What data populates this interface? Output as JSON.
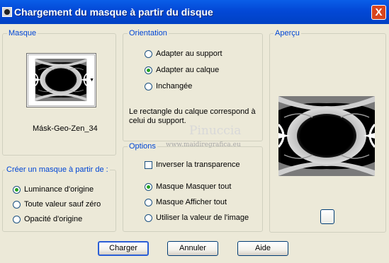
{
  "window": {
    "title": "Chargement du masque à partir du disque",
    "close_label": "X"
  },
  "masque": {
    "legend": "Masque",
    "mask_name": "Másk-Geo-Zen_34",
    "dropdown_arrow": "▼"
  },
  "create_from": {
    "legend": "Créer un masque à partir de :",
    "options": [
      {
        "label": "Luminance d'origine",
        "checked": true
      },
      {
        "label": "Toute valeur sauf zéro",
        "checked": false
      },
      {
        "label": "Opacité d'origine",
        "checked": false
      }
    ]
  },
  "orientation": {
    "legend": "Orientation",
    "options": [
      {
        "label": "Adapter au support",
        "checked": false
      },
      {
        "label": "Adapter au calque",
        "checked": true
      },
      {
        "label": "Inchangée",
        "checked": false
      }
    ],
    "note": "Le rectangle du calque correspond à celui du support."
  },
  "options": {
    "legend": "Options",
    "invert_label": "Inverser la transparence",
    "invert_checked": false,
    "choices": [
      {
        "label": "Masque Masquer tout",
        "checked": true
      },
      {
        "label": "Masque Afficher tout",
        "checked": false
      },
      {
        "label": "Utiliser la valeur de l'image",
        "checked": false
      }
    ]
  },
  "preview": {
    "legend": "Aperçu"
  },
  "watermark": {
    "name": "Pinuccia",
    "url": "www.maidiregrafica.eu"
  },
  "buttons": {
    "load": "Charger",
    "cancel": "Annuler",
    "help": "Aide"
  },
  "colors": {
    "titlebar": "#0348d6",
    "legend_text": "#0046d5",
    "dialog_bg": "#ece9d8",
    "radio_selected": "#21a121"
  }
}
